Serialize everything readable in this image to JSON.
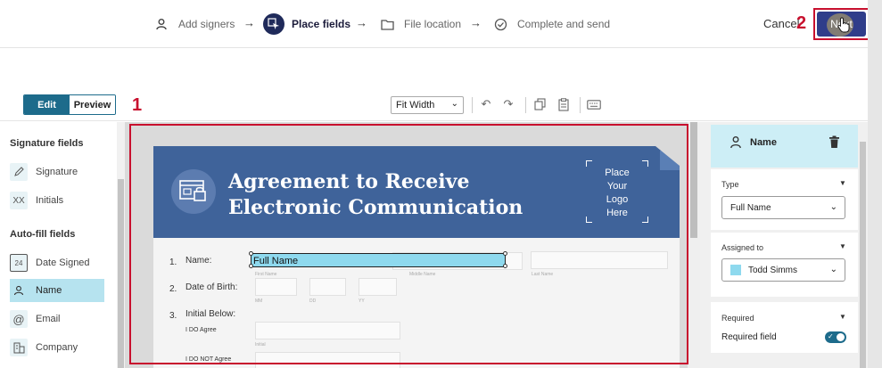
{
  "wizard": {
    "steps": [
      {
        "label": "Add signers",
        "icon": "person-icon"
      },
      {
        "label": "Place fields",
        "icon": "cursor-pointer-icon"
      },
      {
        "label": "File location",
        "icon": "folder-icon"
      },
      {
        "label": "Complete and send",
        "icon": "check-circle-icon"
      }
    ],
    "active_step": "Place fields",
    "cancel_label": "Cancel",
    "next_label": "Next"
  },
  "annotations": {
    "label_1": "1",
    "label_2": "2"
  },
  "toolbar": {
    "edit_label": "Edit",
    "preview_label": "Preview",
    "zoom_value": "Fit Width",
    "icons": [
      "undo-icon",
      "redo-icon",
      "copy-icon",
      "paste-icon",
      "keyboard-icon"
    ]
  },
  "left_panel": {
    "signature_heading": "Signature fields",
    "signature_items": [
      {
        "label": "Signature",
        "icon": "pen-icon"
      },
      {
        "label": "Initials",
        "icon": "initials-icon",
        "glyph": "XX"
      }
    ],
    "autofill_heading": "Auto-fill fields",
    "autofill_items": [
      {
        "label": "Date Signed",
        "icon": "calendar-icon",
        "glyph": "24"
      },
      {
        "label": "Name",
        "icon": "person-icon",
        "selected": true
      },
      {
        "label": "Email",
        "icon": "at-icon",
        "glyph": "@"
      },
      {
        "label": "Company",
        "icon": "building-icon"
      }
    ]
  },
  "document": {
    "title_line1": "Agreement to Receive",
    "title_line2": "Electronic Communication",
    "logo_text": [
      "Place",
      "Your",
      "Logo",
      "Here"
    ],
    "fields": {
      "name_num": "1.",
      "name_label": "Name:",
      "dob_num": "2.",
      "dob_label": "Date of Birth:",
      "initial_num": "3.",
      "initial_label": "Initial Below:",
      "agree_label": "I DO Agree",
      "not_agree_label": "I DO NOT Agree",
      "placed_field_text": "Full Name"
    },
    "sublabels": {
      "first": "First Name",
      "middle": "Middle Name",
      "last": "Last Name",
      "mm": "MM",
      "dd": "DD",
      "yy": "YY",
      "initial": "Initial"
    }
  },
  "right_panel": {
    "field_title": "Name",
    "type_label": "Type",
    "type_value": "Full Name",
    "assigned_label": "Assigned to",
    "assigned_value": "Todd Simms",
    "assigned_color": "#8ed9ee",
    "required_label": "Required",
    "required_field_label": "Required field",
    "required_on": true
  },
  "colors": {
    "accent": "#1d6b8b",
    "banner": "#3f639a",
    "annotation": "#c8102e",
    "next_button": "#2f3d8a"
  }
}
